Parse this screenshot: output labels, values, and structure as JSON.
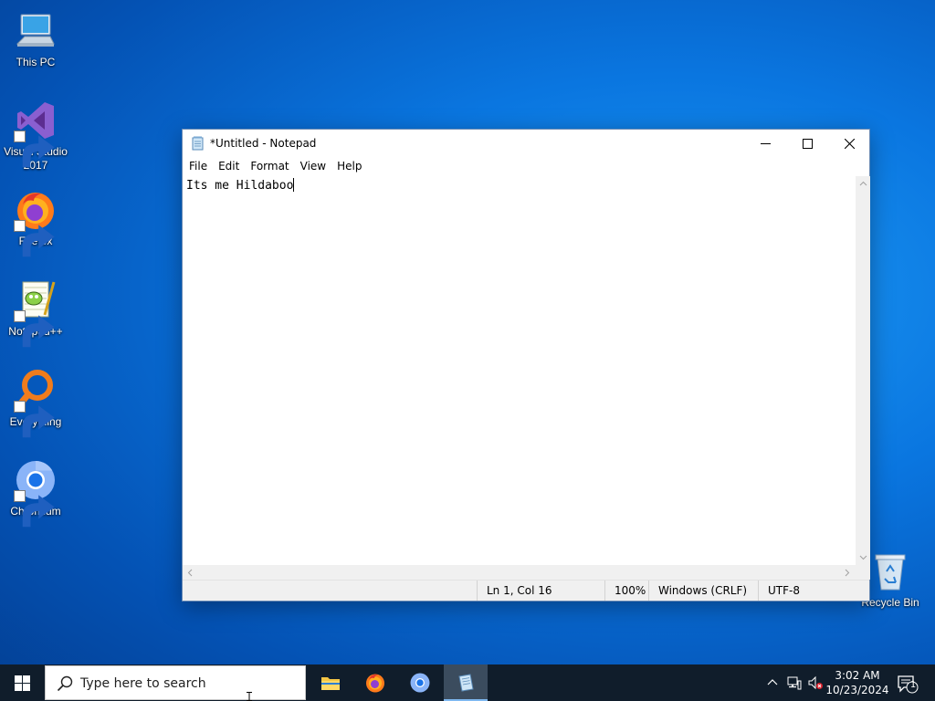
{
  "desktop": {
    "icons": [
      {
        "label": "This PC",
        "icon": "computer-icon",
        "shortcut": false
      },
      {
        "label": "Visual Studio 2017",
        "icon": "visual-studio-icon",
        "shortcut": true
      },
      {
        "label": "Firefox",
        "icon": "firefox-icon",
        "shortcut": true
      },
      {
        "label": "Notepad++",
        "icon": "notepadpp-icon",
        "shortcut": true
      },
      {
        "label": "Everything",
        "icon": "everything-icon",
        "shortcut": true
      },
      {
        "label": "Chromium",
        "icon": "chromium-icon",
        "shortcut": true
      }
    ],
    "recycle_bin": {
      "label": "Recycle Bin",
      "icon": "recycle-bin-icon"
    }
  },
  "notepad": {
    "title": "*Untitled - Notepad",
    "menu": [
      {
        "label": "File"
      },
      {
        "label": "Edit"
      },
      {
        "label": "Format"
      },
      {
        "label": "View"
      },
      {
        "label": "Help"
      }
    ],
    "content": "Its me Hildaboo",
    "status": {
      "position": "Ln 1, Col 16",
      "zoom": "100%",
      "line_ending": "Windows (CRLF)",
      "encoding": "UTF-8"
    }
  },
  "taskbar": {
    "search_placeholder": "Type here to search",
    "pinned_apps": [
      "file-explorer-icon",
      "firefox-icon",
      "chromium-icon",
      "notepad-icon"
    ],
    "active_app": "notepad-icon",
    "clock": {
      "time": "3:02 AM",
      "date": "10/23/2024"
    },
    "notification_count": "1"
  },
  "colors": {
    "desktop_accent": "#0a76e0",
    "taskbar": "#101d2b",
    "active_indicator": "#7fb8f0"
  }
}
